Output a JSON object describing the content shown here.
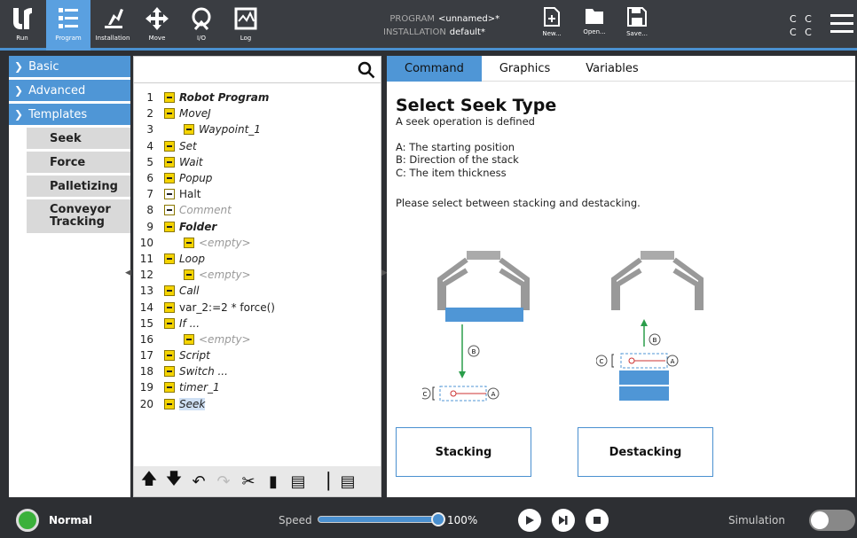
{
  "topbar": {
    "nav": [
      {
        "label": "Run",
        "icon": "ur-logo-icon"
      },
      {
        "label": "Program",
        "icon": "program-icon"
      },
      {
        "label": "Installation",
        "icon": "installation-icon"
      },
      {
        "label": "Move",
        "icon": "move-icon"
      },
      {
        "label": "I/O",
        "icon": "io-icon"
      },
      {
        "label": "Log",
        "icon": "log-icon"
      }
    ],
    "program_label": "PROGRAM",
    "program_value": "<unnamed>*",
    "installation_label": "INSTALLATION",
    "installation_value": "default*",
    "new_label": "New...",
    "open_label": "Open...",
    "save_label": "Save...",
    "cc_line1": "C C",
    "cc_line2": "C C"
  },
  "leftnav": {
    "sections": [
      {
        "label": "Basic"
      },
      {
        "label": "Advanced"
      },
      {
        "label": "Templates"
      }
    ],
    "templates": [
      {
        "label": "Seek"
      },
      {
        "label": "Force"
      },
      {
        "label": "Palletizing"
      },
      {
        "label": "Conveyor Tracking"
      }
    ]
  },
  "tree": {
    "search_placeholder": "",
    "lines": [
      {
        "num": "1",
        "text": "Robot Program",
        "style": "bold"
      },
      {
        "num": "2",
        "text": "MoveJ",
        "style": "it"
      },
      {
        "num": "3",
        "text": "Waypoint_1",
        "style": "it"
      },
      {
        "num": "4",
        "text": "Set",
        "style": "it"
      },
      {
        "num": "5",
        "text": "Wait",
        "style": "it"
      },
      {
        "num": "6",
        "text": "Popup",
        "style": "it"
      },
      {
        "num": "7",
        "text": "Halt",
        "style": ""
      },
      {
        "num": "8",
        "text": "Comment",
        "style": "gray"
      },
      {
        "num": "9",
        "text": "Folder",
        "style": "bold"
      },
      {
        "num": "10",
        "text": "<empty>",
        "style": "gray"
      },
      {
        "num": "11",
        "text": "Loop",
        "style": "it"
      },
      {
        "num": "12",
        "text": "<empty>",
        "style": "gray"
      },
      {
        "num": "13",
        "text": "Call",
        "style": "it"
      },
      {
        "num": "14",
        "text": "var_2:=2 * force()",
        "style": ""
      },
      {
        "num": "15",
        "text": "If ...",
        "style": "it"
      },
      {
        "num": "16",
        "text": "<empty>",
        "style": "gray"
      },
      {
        "num": "17",
        "text": "Script",
        "style": "it"
      },
      {
        "num": "18",
        "text": "Switch ...",
        "style": "it"
      },
      {
        "num": "19",
        "text": "timer_1",
        "style": "it"
      },
      {
        "num": "20",
        "text": "Seek",
        "style": "it"
      }
    ]
  },
  "tabs": [
    "Command",
    "Graphics",
    "Variables"
  ],
  "command": {
    "title": "Select Seek Type",
    "intro": "A seek operation is defined",
    "legend_a": "A: The starting position",
    "legend_b": "B: Direction of the stack",
    "legend_c": "C: The item thickness",
    "instruction": "Please select between stacking and destacking.",
    "stacking_label": "Stacking",
    "destacking_label": "Destacking",
    "diagram_a": "A",
    "diagram_b": "B",
    "diagram_c": "C"
  },
  "footer": {
    "status": "Normal",
    "speed_label": "Speed",
    "speed_value": "100%",
    "speed_fraction": 1.0,
    "simulation_label": "Simulation"
  },
  "colors": {
    "accent": "#4f96d6",
    "status_ok": "#3bb13b",
    "topbar": "#3a3d42",
    "node_icon": "#f5d400"
  }
}
